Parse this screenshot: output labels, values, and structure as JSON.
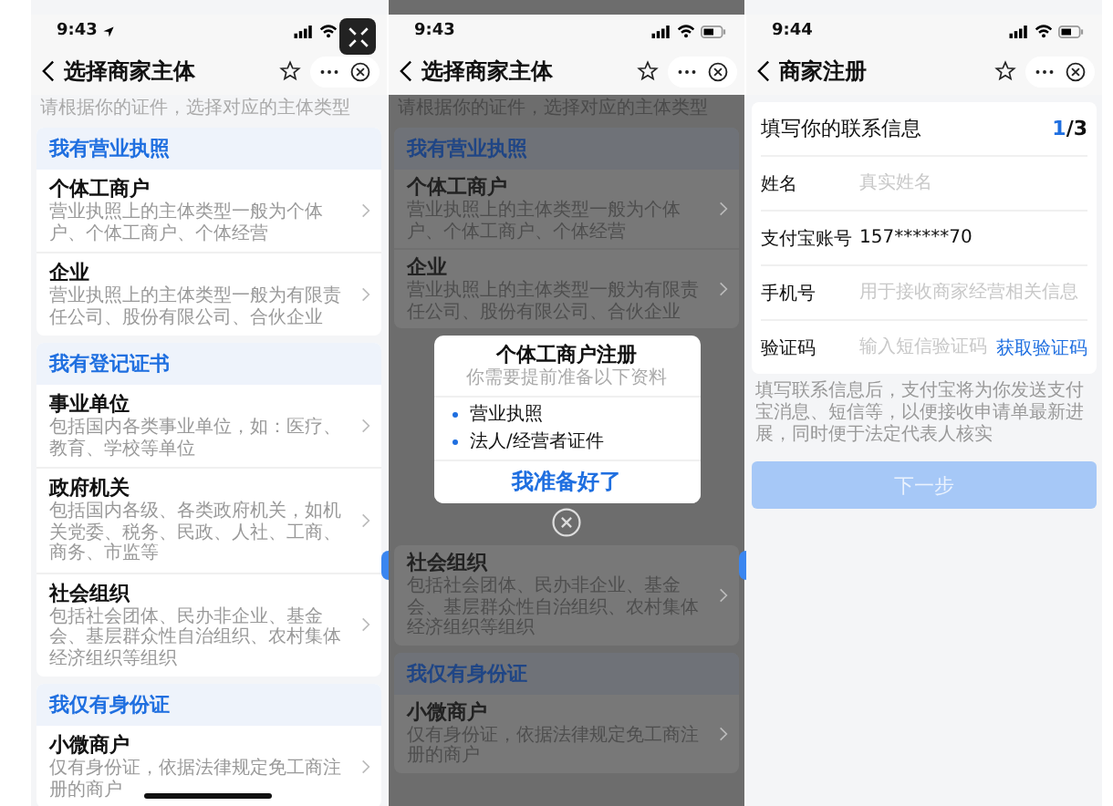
{
  "screens": [
    {
      "kind": "list",
      "status": {
        "time": "9:43",
        "location": true
      },
      "expand_button": true,
      "side_handle": true,
      "home_indicator": true,
      "nav": {
        "title": "选择商家主体"
      },
      "hint": "请根据你的证件，选择对应的主体类型",
      "sections": [
        {
          "title": "我有营业执照",
          "items": [
            {
              "title": "个体工商户",
              "desc": "营业执照上的主体类型一般为个体户、个体工商户、个体经营"
            },
            {
              "title": "企业",
              "desc": "营业执照上的主体类型一般为有限责任公司、股份有限公司、合伙企业"
            }
          ]
        },
        {
          "title": "我有登记证书",
          "items": [
            {
              "title": "事业单位",
              "desc": "包括国内各类事业单位，如：医疗、教育、学校等单位"
            },
            {
              "title": "政府机关",
              "desc": "包括国内各级、各类政府机关，如机关党委、税务、民政、人社、工商、商务、市监等"
            },
            {
              "title": "社会组织",
              "desc": "包括社会团体、民办非企业、基金会、基层群众性自治组织、农村集体经济组织等组织"
            }
          ]
        },
        {
          "title": "我仅有身份证",
          "items": [
            {
              "title": "小微商户",
              "desc": "仅有身份证，依据法律规定免工商注册的商户"
            }
          ]
        }
      ]
    },
    {
      "kind": "modal",
      "status": {
        "time": "9:43"
      },
      "side_handle": true,
      "nav": {
        "title": "选择商家主体"
      },
      "hint": "请根据你的证件，选择对应的主体类型",
      "sections": [
        {
          "title": "我有营业执照",
          "items": [
            {
              "title": "个体工商户",
              "desc": "营业执照上的主体类型一般为个体户、个体工商户、个体经营"
            },
            {
              "title": "企业",
              "desc": "营业执照上的主体类型一般为有限责任公司、股份有限公司、合伙企业"
            }
          ]
        }
      ],
      "modal": {
        "title": "个体工商户注册",
        "subtitle": "你需要提前准备以下资料",
        "materials": [
          "营业执照",
          "法人/经营者证件"
        ],
        "confirm": "我准备好了"
      },
      "sections_after": [
        {
          "items": [
            {
              "title": "社会组织",
              "desc": "包括社会团体、民办非企业、基金会、基层群众性自治组织、农村集体经济组织等组织"
            }
          ]
        },
        {
          "title": "我仅有身份证",
          "items": [
            {
              "title": "小微商户",
              "desc": "仅有身份证，依据法律规定免工商注册的商户"
            }
          ]
        }
      ]
    },
    {
      "kind": "form",
      "status": {
        "time": "9:44"
      },
      "nav": {
        "title": "商家注册"
      },
      "form": {
        "heading": "填写你的联系信息",
        "step_current": "1",
        "step_total": "/3",
        "fields": [
          {
            "label": "姓名",
            "placeholder": "真实姓名"
          },
          {
            "label": "支付宝账号",
            "value": "157******70"
          },
          {
            "label": "手机号",
            "placeholder": "用于接收商家经营相关信息"
          },
          {
            "label": "验证码",
            "placeholder": "输入短信验证码",
            "action": "获取验证码"
          }
        ]
      },
      "note": "填写联系信息后，支付宝将为你发送支付宝消息、短信等，以便接收申请单最新进展，同时便于法定代表人核实",
      "submit": {
        "label": "下一步",
        "disabled": true
      }
    }
  ]
}
